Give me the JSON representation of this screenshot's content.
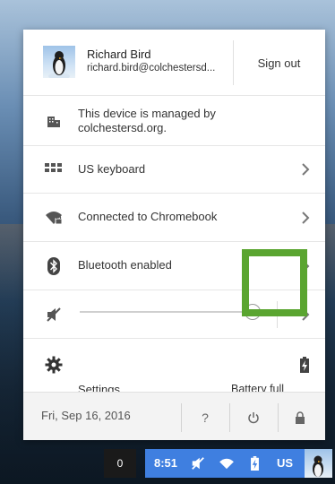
{
  "user": {
    "name": "Richard Bird",
    "email": "richard.bird@colchestersd..."
  },
  "sign_out_label": "Sign out",
  "managed": {
    "line1": "This device is managed by",
    "line2": "colchestersd.org."
  },
  "rows": {
    "keyboard": "US keyboard",
    "network": "Connected to Chromebook",
    "bluetooth": "Bluetooth enabled"
  },
  "volume": {
    "level": 1.0,
    "muted": true
  },
  "settings_label": "Settings",
  "battery_label": "Battery full",
  "footer": {
    "date": "Fri, Sep 16, 2016",
    "help": "?"
  },
  "shelf": {
    "notification_count": "0",
    "time": "8:51",
    "ime": "US"
  },
  "colors": {
    "highlight": "#5aa530",
    "tray": "#3f7fe0"
  }
}
